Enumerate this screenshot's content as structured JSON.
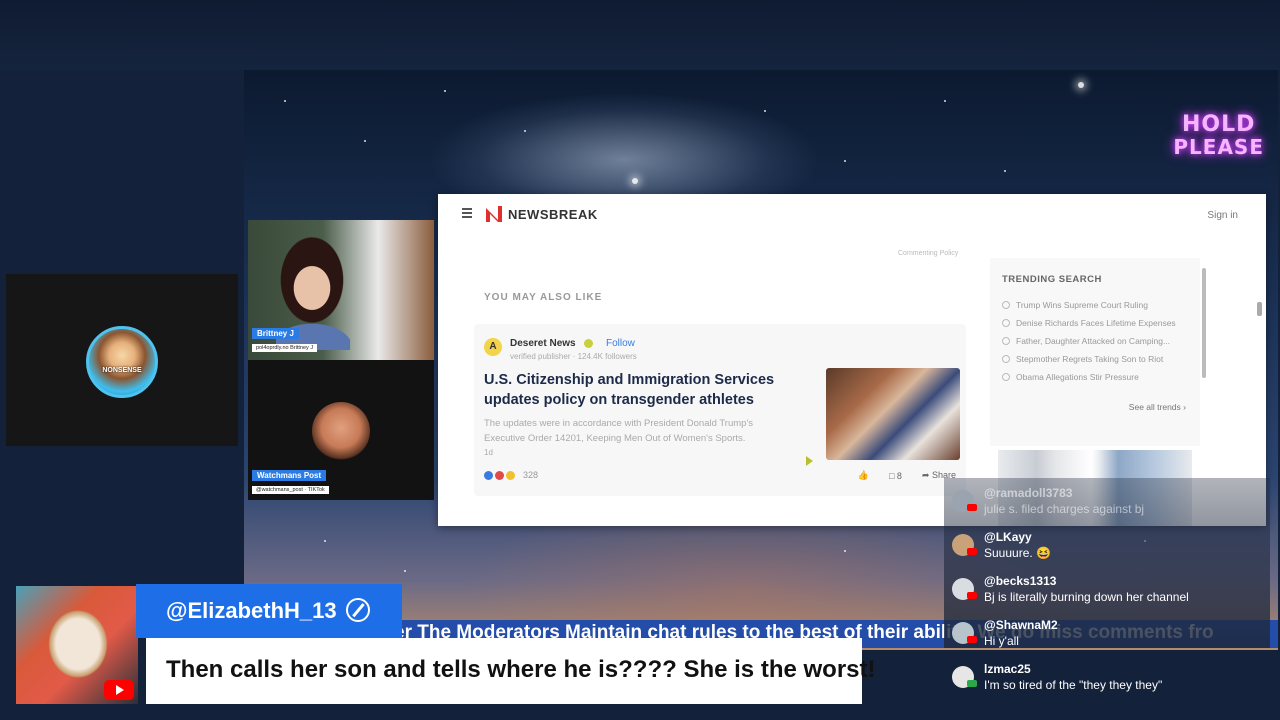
{
  "overlay": {
    "hold_line1": "HOLD",
    "hold_line2": "PLEASE"
  },
  "browser": {
    "brand": "NEWSBREAK",
    "sign_in": "Sign in",
    "commenting_policy": "Commenting Policy",
    "you_may_also_like": "YOU MAY ALSO LIKE",
    "article": {
      "publisher_initial": "A",
      "publisher": "Deseret News",
      "follow": "Follow",
      "publisher_meta": "verified publisher · 124.4K followers",
      "headline": "U.S. Citizenship and Immigration Services updates policy on transgender athletes",
      "summary": "The updates were in accordance with President Donald Trump's Executive Order 14201, Keeping Men Out of Women's Sports.",
      "small_count": "1d",
      "reaction_count": "328",
      "comment_count": "8",
      "share": "Share"
    },
    "trending": {
      "title": "TRENDING SEARCH",
      "items": [
        "Trump Wins Supreme Court Ruling",
        "Denise Richards Faces Lifetime Expenses",
        "Father, Daughter Attacked on Camping...",
        "Stepmother Regrets Taking Son to Riot",
        "Obama Allegations Stir Pressure"
      ],
      "see_all": "See all trends"
    }
  },
  "host": {
    "avatar_text": "NONSENSE"
  },
  "guests": [
    {
      "name": "Brittney J",
      "sub": "pol4oprdly.no Brittney J"
    },
    {
      "name": "Watchmans Post",
      "sub": "@watchmans_post · TIKTok"
    }
  ],
  "ticker": {
    "text": "er The Moderators Maintain chat rules to the best of their ability. We do miss comments fro"
  },
  "featured_comment": {
    "username": "@ElizabethH_13",
    "message": "Then calls her son and tells where he is???? She is the worst!"
  },
  "chat": [
    {
      "user": "@ramadoll3783",
      "text": "julie s. filed charges against bj",
      "avatar_color": "#9aa3b0",
      "badge": "youtube"
    },
    {
      "user": "@LKayy",
      "text": "Suuuure. 😆",
      "avatar_color": "#c9a27a",
      "badge": "youtube"
    },
    {
      "user": "@becks1313",
      "text": "Bj is literally burning down her channel",
      "avatar_color": "#d8dde2",
      "badge": "youtube"
    },
    {
      "user": "@ShawnaM2",
      "text": "Hi y'all",
      "avatar_color": "#b8c4cc",
      "badge": "youtube"
    },
    {
      "user": "lzmac25",
      "text": "I'm so tired of the \"they they they\"",
      "avatar_color": "#e6e6e6",
      "badge": "green"
    }
  ],
  "colors": {
    "accent_blue": "#1e6ee8",
    "ticker_blue": "#234da8",
    "neon_pink": "#d23bff",
    "youtube_red": "#ff0000"
  }
}
